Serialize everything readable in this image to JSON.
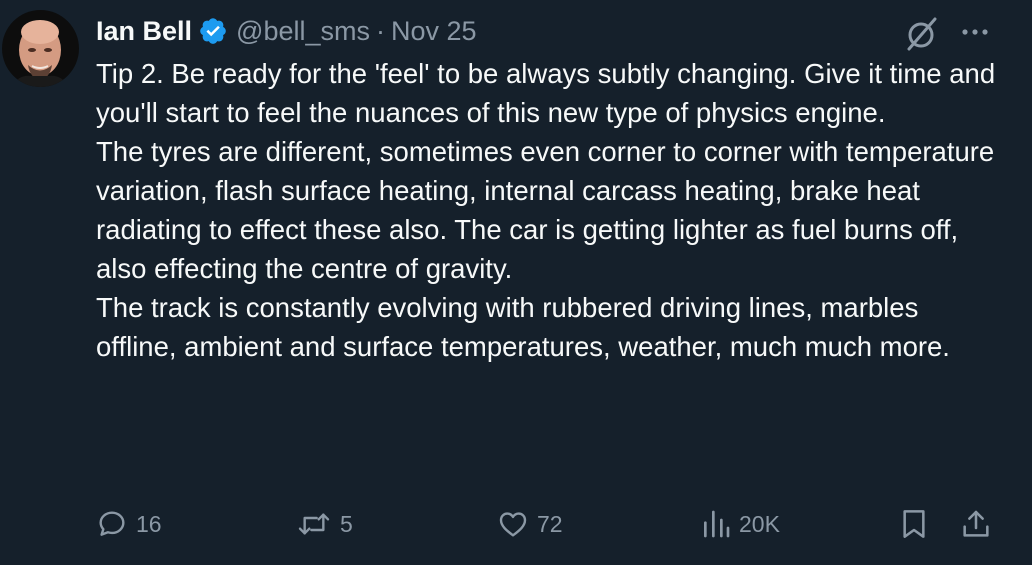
{
  "author": {
    "display_name": "Ian Bell",
    "handle": "@bell_sms",
    "separator": "·",
    "date": "Nov 25",
    "verified": true
  },
  "tweet": {
    "paragraphs": [
      "Tip 2. Be ready for the 'feel' to be always subtly changing. Give it time and you'll start to feel the nuances of this new type of physics engine.",
      "The tyres are different, sometimes even corner to corner with temperature variation, flash surface heating, internal carcass heating, brake heat radiating to effect these also. The car is getting lighter as fuel burns off, also effecting the centre of gravity.",
      "The track is constantly evolving with rubbered driving lines, marbles offline, ambient and surface temperatures, weather, much much more."
    ]
  },
  "actions": {
    "replies": "16",
    "reposts": "5",
    "likes": "72",
    "views": "20K"
  },
  "icons": {
    "verified": "verified-badge-icon",
    "grok": "grok-icon",
    "more": "more-icon",
    "reply": "reply-icon",
    "repost": "repost-icon",
    "like": "heart-icon",
    "views": "views-icon",
    "bookmark": "bookmark-icon",
    "share": "share-icon"
  },
  "colors": {
    "background": "#15202b",
    "text_primary": "#f7f9f9",
    "text_secondary": "#8b98a5",
    "verified_blue": "#1d9bf0"
  }
}
